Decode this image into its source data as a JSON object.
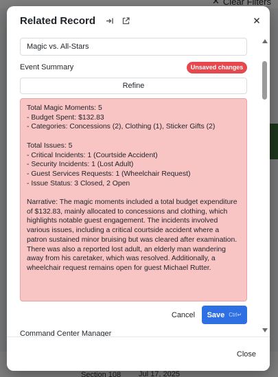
{
  "background": {
    "clear_filters": "Clear Filters",
    "section": "Section 108",
    "date": "Jul 17, 2025"
  },
  "modal": {
    "title": "Related Record",
    "event_name_value": "Magic vs. All-Stars",
    "summary_label": "Event Summary",
    "unsaved_badge": "Unsaved changes",
    "refine_label": "Refine",
    "summary_text": "Total Magic Moments: 5\n- Budget Spent: $132.83\n- Categories: Concessions (2), Clothing (1), Sticker Gifts (2)\n\nTotal Issues: 5\n- Critical Incidents: 1 (Courtside Accident)\n- Security Incidents: 1 (Lost Adult)\n- Guest Services Requests: 1 (Wheelchair Request)\n- Issue Status: 3 Closed, 2 Open\n\nNarrative: The magic moments included a total budget expenditure of $132.83, mainly allocated to concessions and clothing, which highlights notable guest engagement. The incidents involved various issues, including a critical courtside accident where a patron sustained minor bruising but was cleared after examination. There was also a reported lost adult, an elderly man wandering away from his caretaker, which was resolved. Additionally, a wheelchair request remains open for guest Michael Rutter.",
    "cancel_label": "Cancel",
    "save_label": "Save",
    "save_shortcut": "Ctrl↵",
    "manager_label": "Command Center Manager",
    "close_label": "Close"
  },
  "colors": {
    "primary": "#2f6fe4",
    "badge": "#e5484d",
    "summary_bg": "#f8c4c4"
  }
}
